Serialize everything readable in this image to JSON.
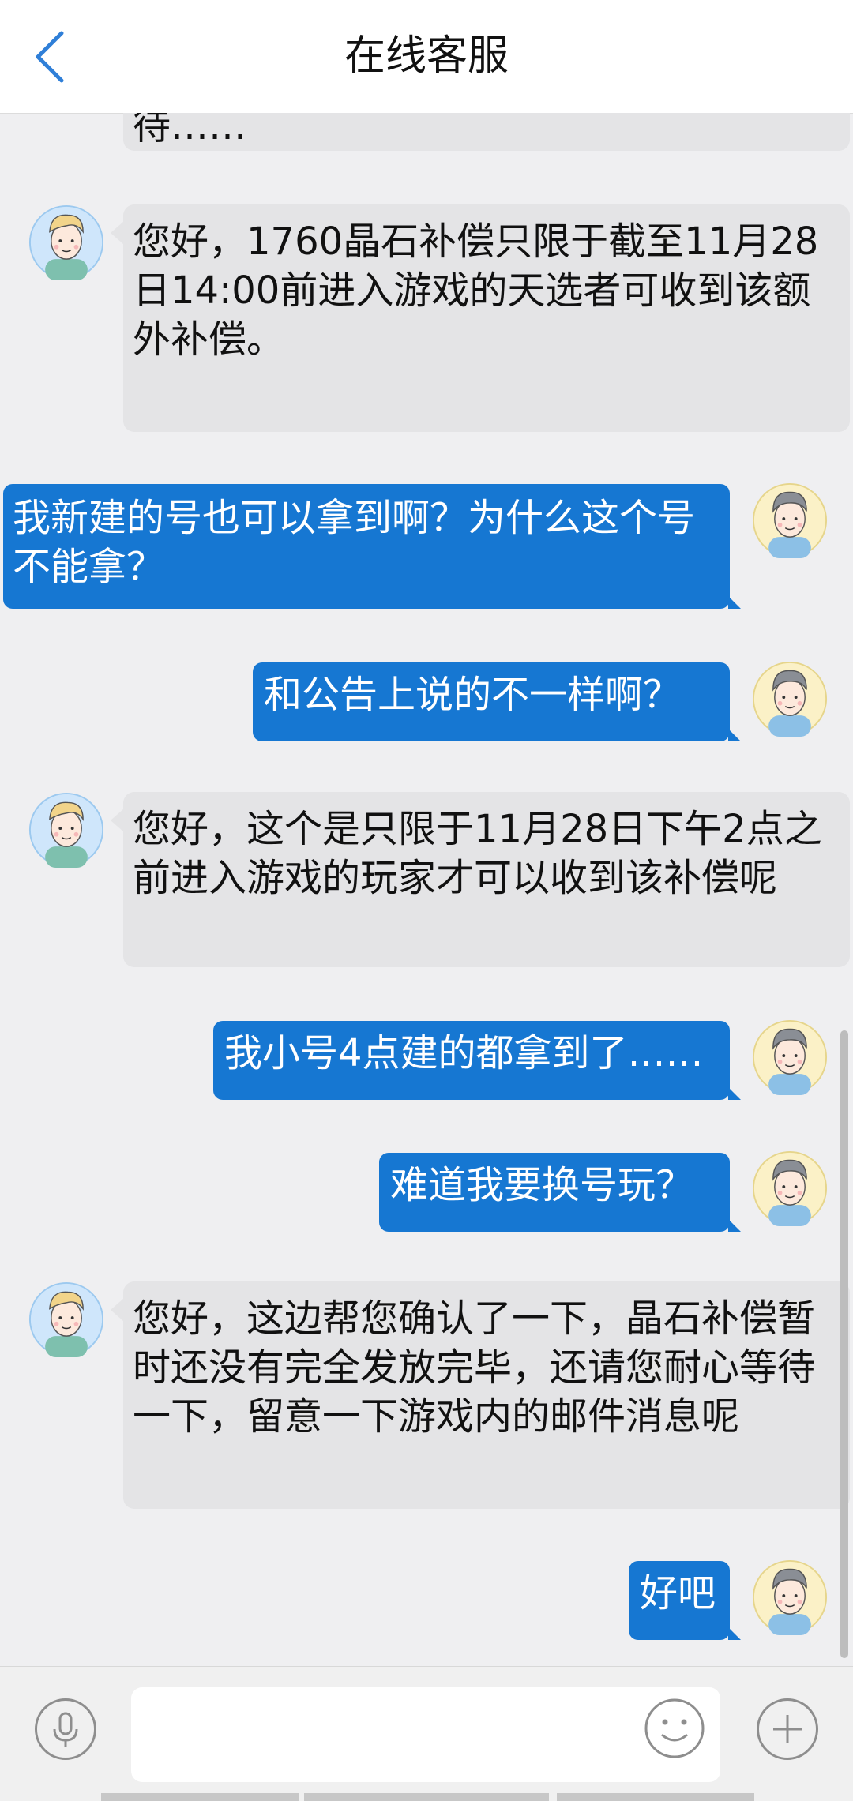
{
  "header": {
    "title": "在线客服"
  },
  "messages": [
    {
      "from": "agent",
      "text": "待……"
    },
    {
      "from": "agent",
      "text": "您好，1760晶石补偿只限于截至11月28日14:00前进入游戏的天选者可收到该额外补偿。"
    },
    {
      "from": "user",
      "text": "我新建的号也可以拿到啊？为什么这个号不能拿？"
    },
    {
      "from": "user",
      "text": "和公告上说的不一样啊？"
    },
    {
      "from": "agent",
      "text": "您好，这个是只限于11月28日下午2点之前进入游戏的玩家才可以收到该补偿呢"
    },
    {
      "from": "user",
      "text": "我小号4点建的都拿到了……"
    },
    {
      "from": "user",
      "text": "难道我要换号玩？"
    },
    {
      "from": "agent",
      "text": "您好，这边帮您确认了一下，晶石补偿暂时还没有完全发放完毕，还请您耐心等待一下，留意一下游戏内的邮件消息呢"
    },
    {
      "from": "user",
      "text": "好吧"
    }
  ],
  "input": {
    "value": "",
    "placeholder": ""
  },
  "icons": {
    "back": "chevron-left-icon",
    "voice": "microphone-icon",
    "emoji": "smiley-icon",
    "more": "plus-icon"
  },
  "colors": {
    "user_bubble": "#1677d2",
    "agent_bubble": "#e4e4e6",
    "background": "#efeff1",
    "back_arrow": "#2f7fd8"
  }
}
